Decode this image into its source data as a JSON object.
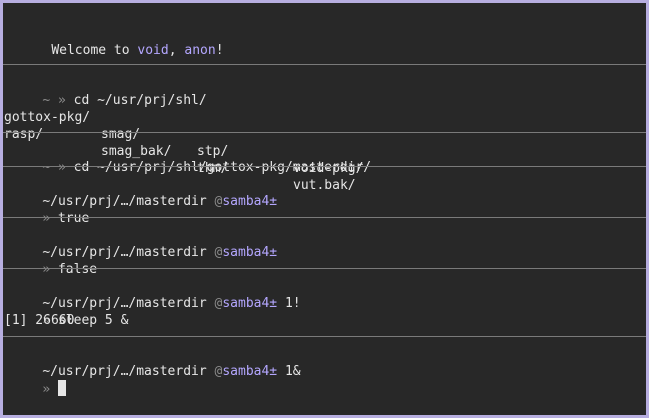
{
  "welcome": {
    "prefix": "Welcome to ",
    "host": "void",
    "sep": ", ",
    "user": "anon",
    "suffix": "!"
  },
  "prompt": {
    "tilde": "~",
    "arrow": "»",
    "at": "@",
    "cwd": "~/usr/prj/…/masterdir",
    "branch": "samba4±"
  },
  "blocks": [
    {
      "command": "cd ~/usr/prj/shl/",
      "ls": [
        [
          "gottox-pkg/",
          "smag/",
          "stp/",
          "void-pkg/"
        ],
        [
          "rasp/",
          "smag_bak/",
          "thm/",
          "vut.bak/"
        ]
      ]
    },
    {
      "command": "cd ~/usr/prj/shl/gottox-pkg/masterdir/"
    },
    {
      "command": "true"
    },
    {
      "command": "false"
    },
    {
      "status": "1!",
      "command": "sleep 5 &",
      "output": "[1] 26660"
    },
    {
      "status": "1&"
    }
  ],
  "colors": {
    "background": "#282828",
    "frame": "#b7aee0",
    "accent": "#b4a7ff",
    "separator": "#7a7a7a"
  }
}
